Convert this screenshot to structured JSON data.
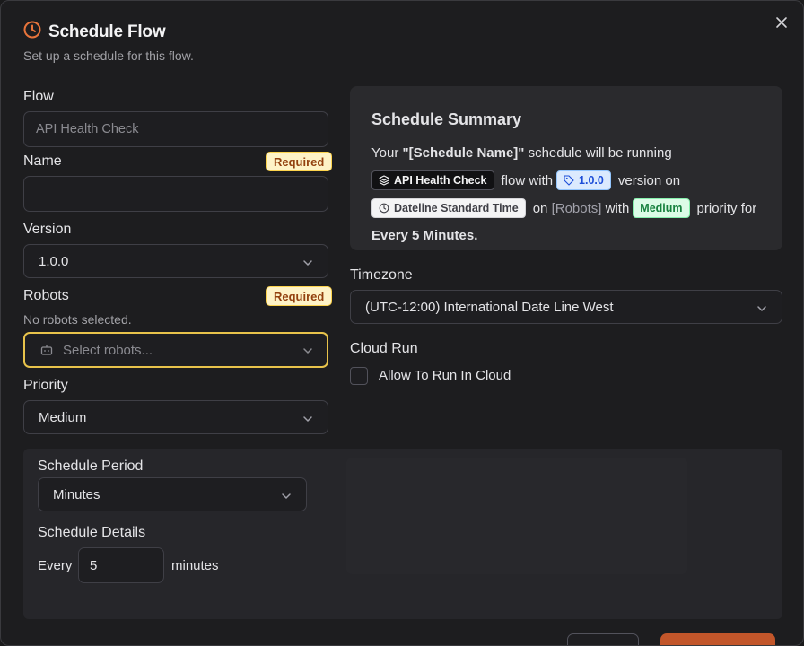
{
  "dialog": {
    "title": "Schedule Flow",
    "subtitle": "Set up a schedule for this flow.",
    "accent_color": "#e8743b"
  },
  "form": {
    "flow": {
      "label": "Flow",
      "value": "API Health Check"
    },
    "name": {
      "label": "Name",
      "badge": "Required",
      "value": ""
    },
    "version": {
      "label": "Version",
      "value": "1.0.0"
    },
    "robots": {
      "label": "Robots",
      "badge": "Required",
      "hint": "No robots selected.",
      "placeholder": "Select robots..."
    },
    "priority": {
      "label": "Priority",
      "value": "Medium"
    }
  },
  "summary": {
    "title": "Schedule Summary",
    "line1_prefix": "Your",
    "schedule_name": "\"[Schedule Name]\"",
    "line1_suffix": "schedule will be running",
    "flow_chip": "API Health Check",
    "flow_with": "flow with",
    "version_chip": "1.0.0",
    "version_on": "version on",
    "timezone_chip": "Dateline Standard Time",
    "on_text": "on",
    "robots_text": "[Robots]",
    "with_text": "with",
    "priority_chip": "Medium",
    "priority_for": "priority for",
    "frequency": "Every 5 Minutes."
  },
  "timezone": {
    "label": "Timezone",
    "value": "(UTC-12:00) International Date Line West"
  },
  "cloud_run": {
    "label": "Cloud Run",
    "checkbox_label": "Allow To Run In Cloud",
    "checked": false
  },
  "schedule": {
    "period_label": "Schedule Period",
    "period_value": "Minutes",
    "details_label": "Schedule Details",
    "every_text": "Every",
    "interval_value": "5",
    "unit_text": "minutes"
  }
}
